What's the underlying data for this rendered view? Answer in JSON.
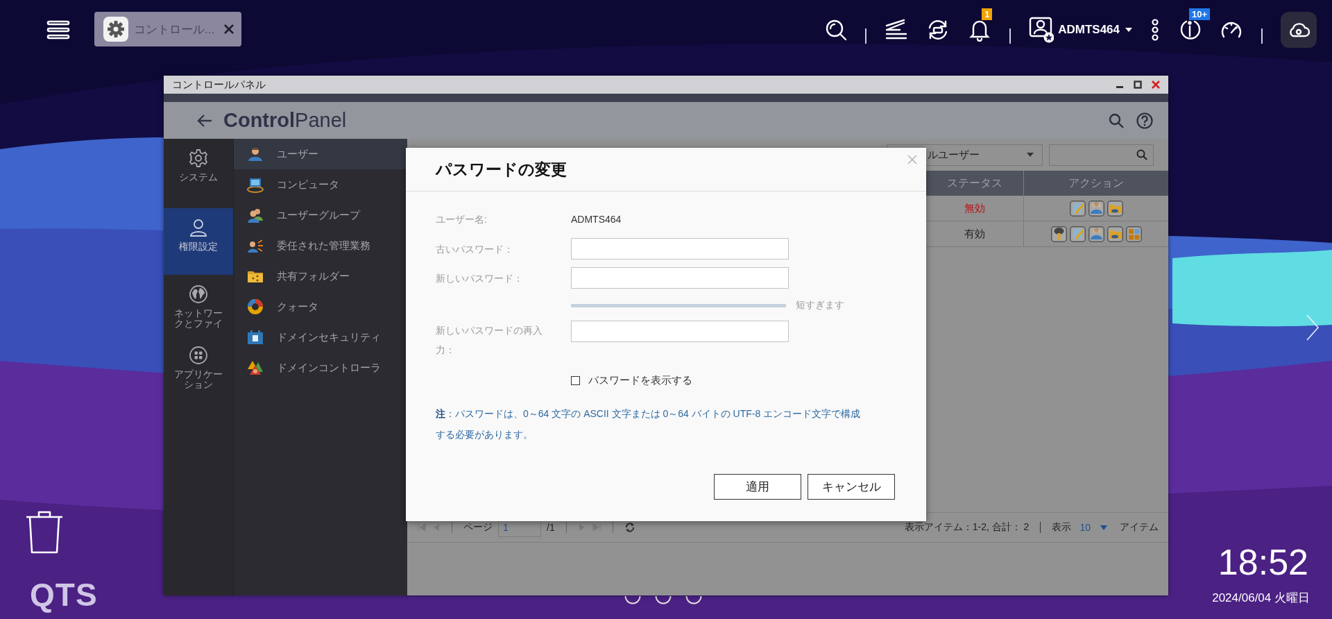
{
  "top_bar": {
    "tab": {
      "label": "コントロール..."
    },
    "notification_count": "1",
    "user_name": "ADMTS464",
    "update_count": "10+"
  },
  "window": {
    "title": "コントロールパネル",
    "app_title": "**Control**Panel",
    "main_nav": [
      {
        "label": "システム",
        "selected": false
      },
      {
        "label": "権限設定",
        "selected": true
      },
      {
        "label": "ネットワークとファイ",
        "selected": false
      },
      {
        "label": "アプリケーション",
        "selected": false
      }
    ],
    "sub_nav": [
      {
        "label": "ユーザー",
        "selected": true
      },
      {
        "label": "コンピュータ",
        "selected": false
      },
      {
        "label": "ユーザーグループ",
        "selected": false
      },
      {
        "label": "委任された管理業務",
        "selected": false
      },
      {
        "label": "共有フォルダー",
        "selected": false
      },
      {
        "label": "クォータ",
        "selected": false
      },
      {
        "label": "ドメインセキュリティ",
        "selected": false
      },
      {
        "label": "ドメインコントローラ",
        "selected": false
      }
    ],
    "filter": {
      "value": "ルユーザー"
    },
    "table": {
      "columns": [
        "ステータス",
        "アクション"
      ],
      "rows": [
        {
          "status": "無効",
          "enabled": false,
          "actions": [
            {
              "kind": "edit"
            },
            {
              "kind": "group"
            },
            {
              "kind": "folder"
            }
          ]
        },
        {
          "status": "有効",
          "enabled": true,
          "actions": [
            {
              "kind": "key"
            },
            {
              "kind": "edit"
            },
            {
              "kind": "group"
            },
            {
              "kind": "folder"
            },
            {
              "kind": "apps"
            }
          ]
        }
      ]
    },
    "pager": {
      "page_label": "ページ",
      "page": "1",
      "page_total": "/1",
      "summary": "表示アイテム：1-2, 合計： 2",
      "per_page_label": "表示",
      "per_page": "10",
      "items_label": "アイテム"
    }
  },
  "dialog": {
    "title": "パスワードの変更",
    "fields": [
      {
        "kind": "text",
        "label": "ユーザー名:",
        "value": "ADMTS464"
      },
      {
        "kind": "password",
        "label": "古いパスワード："
      },
      {
        "kind": "password",
        "label": "新しいパスワード："
      },
      {
        "kind": "strength",
        "level": 0,
        "reading": "短すぎます"
      },
      {
        "kind": "password",
        "label": "新しいパスワードの再入力："
      }
    ],
    "show_password": {
      "label": "パスワードを表示する",
      "checked": false
    },
    "note": "**注**：パスワードは、0～64 文字の ASCII 文字または 0～64 バイトの UTF-8 エンコード文字で構成する必要があります。",
    "buttons": [
      "適用",
      "キャンセル"
    ]
  },
  "desktop": {
    "logo": "QTS",
    "time": "18:52",
    "date": "2024/06/04 火曜日"
  }
}
